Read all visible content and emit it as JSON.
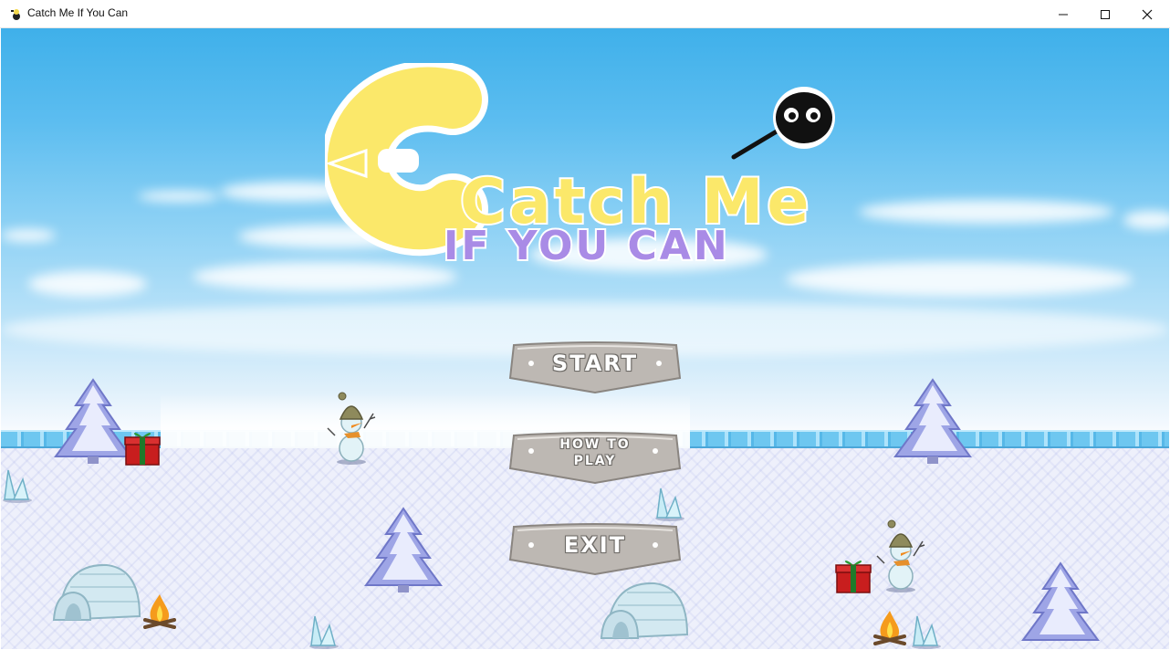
{
  "window": {
    "title": "Catch Me If You Can",
    "controls": {
      "minimize": "minimize",
      "maximize": "maximize",
      "close": "close"
    }
  },
  "logo": {
    "line1": "Catch Me",
    "line2": "IF YOU CAN",
    "colors": {
      "line1": "#fbe86a",
      "line2": "#a98be6",
      "outline": "#ffffff"
    }
  },
  "menu": {
    "start_label": "START",
    "howto_label_1": "HOW TO",
    "howto_label_2": "PLAY",
    "exit_label": "EXIT"
  },
  "colors": {
    "sky_top": "#3fb0ea",
    "ice_rail": "#6ec7f0",
    "button_face": "#bdb8b3",
    "button_border": "#8a8580"
  },
  "scene_objects": [
    "pine-tree",
    "gift-box",
    "snowman",
    "igloo",
    "campfire",
    "ice-crystal"
  ]
}
